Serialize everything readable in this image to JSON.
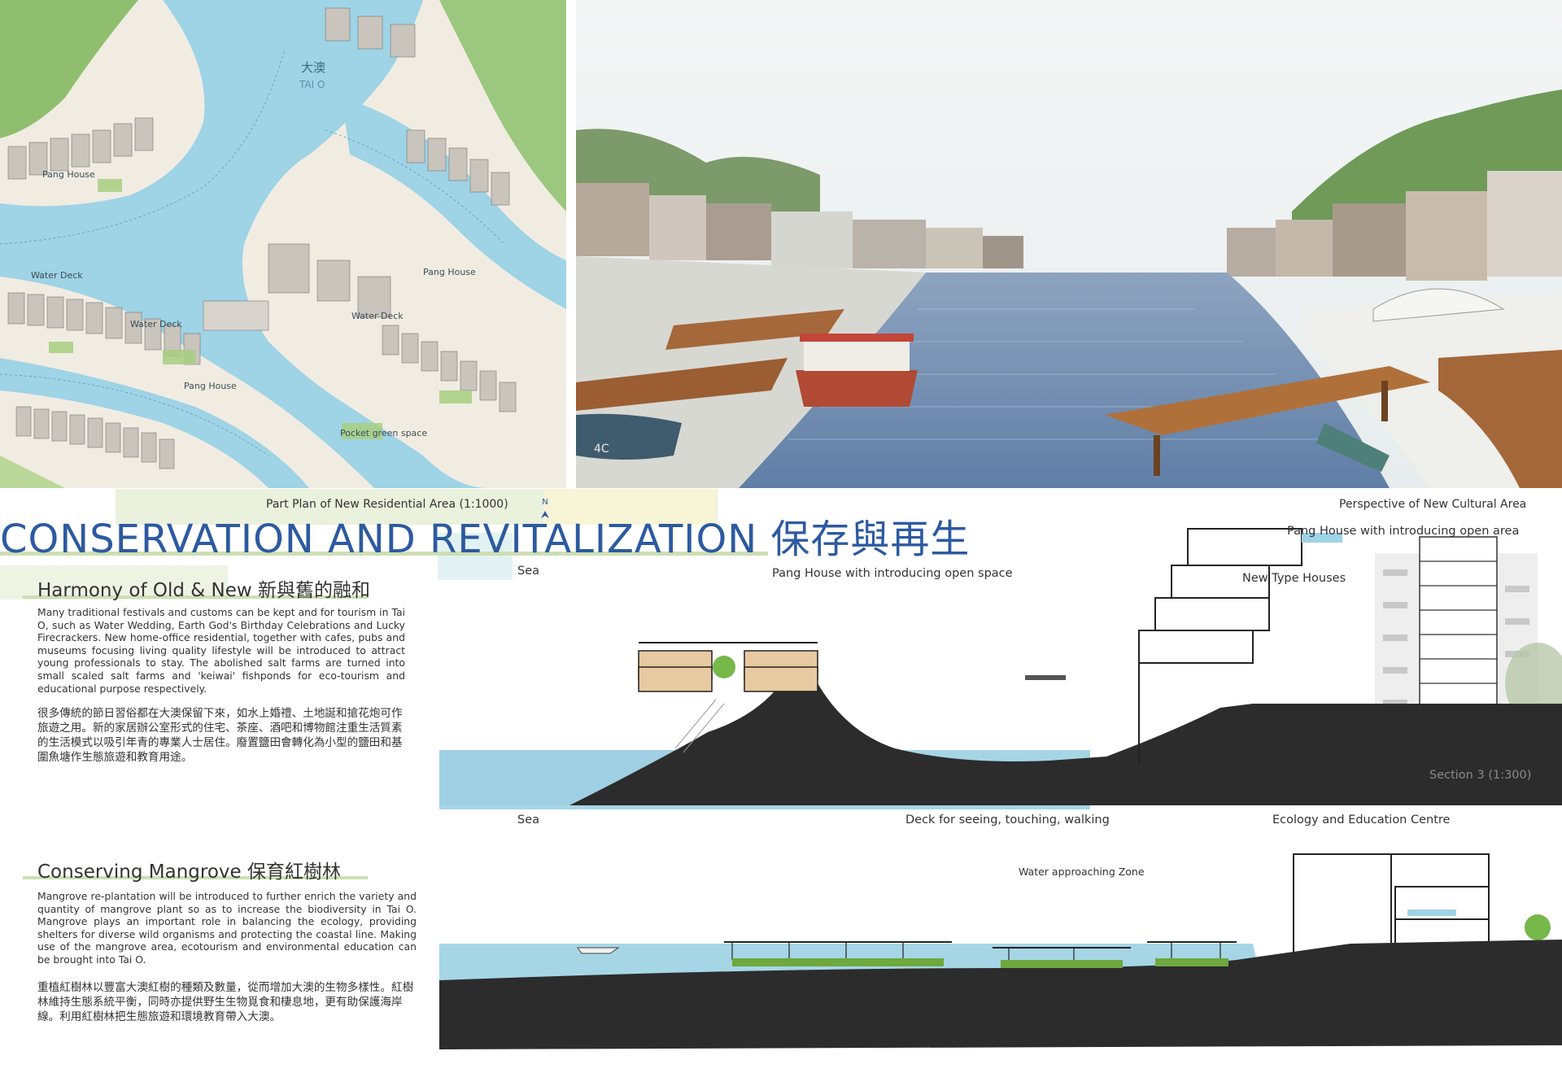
{
  "map": {
    "caption": "Part Plan of New Residential Area (1:1000)",
    "north_label": "N",
    "labels": {
      "place_zh": "大澳",
      "place_en": "TAI O",
      "pang_house_1": "Pang House",
      "pang_house_2": "Pang House",
      "pang_house_3": "Pang House",
      "water_deck_1": "Water Deck",
      "water_deck_2": "Water Deck",
      "water_deck_3": "Water Deck",
      "pocket_green": "Pocket green space"
    }
  },
  "perspective": {
    "caption": "Perspective of New Cultural Area",
    "boat_number": "4C"
  },
  "title": {
    "main": "CONSERVATION AND REVITALIZATION 保存與再生"
  },
  "harmony": {
    "heading": "Harmony of Old & New 新與舊的融和",
    "body_en": "Many traditional festivals and customs can be kept and for tourism in Tai O, such as Water Wedding, Earth God's Birthday Celebrations and Lucky Firecrackers. New home-office residential, together with cafes, pubs and museums focusing living quality lifestyle will be introduced to attract young professionals to stay. The abolished salt farms are turned into small scaled salt farms and 'keiwai' fishponds for eco-tourism and educational purpose respectively.",
    "body_zh": "很多傳統的節日習俗都在大澳保留下來，如水上婚禮、土地誕和搶花炮可作旅遊之用。新的家居辦公室形式的住宅、茶座、酒吧和博物館注重生活質素的生活模式以吸引年青的專業人士居住。廢置鹽田會轉化為小型的鹽田和基圍魚塘作生態旅遊和教育用途。"
  },
  "mangrove": {
    "heading": "Conserving Mangrove 保育紅樹林",
    "body_en": "Mangrove re-plantation will be introduced to further enrich the variety and quantity of mangrove plant so as to increase the biodiversity in Tai O. Mangrove plays an important role in balancing the ecology, providing shelters for diverse wild organisms and protecting the coastal line. Making use of the mangrove area, ecotourism and environmental education can be brought into Tai O.",
    "body_zh": "重植紅樹林以豐富大澳紅樹的種類及數量，從而增加大澳的生物多樣性。紅樹林維持生態系統平衡，同時亦提供野生生物覓食和棲息地，更有助保護海岸線。利用紅樹林把生態旅遊和環境教育帶入大澳。"
  },
  "section3": {
    "label_sea": "Sea",
    "label_pang_open_space": "Pang House with introducing open space",
    "label_pang_open_area": "Pang House with introducing open area",
    "label_new_type": "New Type Houses",
    "scale": "Section 3 (1:300)"
  },
  "section4": {
    "label_sea": "Sea",
    "label_deck": "Deck  for seeing, touching, walking",
    "label_eco": "Ecology and Education Centre",
    "label_water_zone": "Water approaching Zone"
  },
  "colors": {
    "title_blue": "#2d5aa0",
    "water": "#9fd3e6",
    "ground": "#2c2c2c",
    "wood": "#b0703a"
  }
}
